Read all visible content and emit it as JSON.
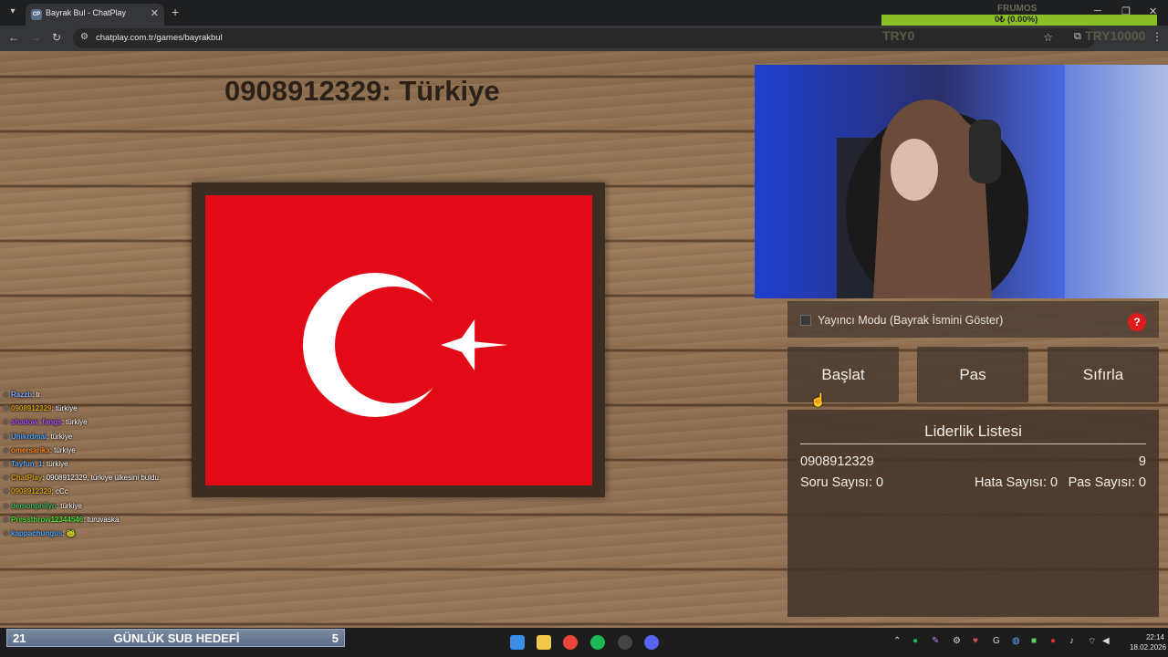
{
  "browser": {
    "tab_title": "Bayrak Bul - ChatPlay",
    "tab_favicon_text": "CP",
    "url": "chatplay.com.tr/games/bayrakbul",
    "new_tab_icon": "plus-icon",
    "close_tab_icon": "close-icon"
  },
  "overlay": {
    "label": "FRUMOS",
    "progress_text": "0₺ (0.00%)",
    "progress": 0,
    "start_amount": "TRY0",
    "goal_amount": "TRY10000",
    "bar_color": "#8bbd24"
  },
  "game": {
    "headline": "0908912329: Türkiye",
    "flag_country": "Türkiye",
    "flag_color": "#e30a17"
  },
  "chat": [
    {
      "user": "Razzb",
      "message": "tr",
      "color": "#7fa8ff"
    },
    {
      "user": "0908912329",
      "message": "türkiye",
      "color": "#d4a017"
    },
    {
      "user": "shadow_fangs",
      "message": "türkiye",
      "color": "#b04fff"
    },
    {
      "user": "Unikrdmal",
      "message": "türkiye",
      "color": "#4fa3ff"
    },
    {
      "user": "omersarika",
      "message": "türkiye",
      "color": "#ff8a1f"
    },
    {
      "user": "Tayfun_1",
      "message": "türkiye",
      "color": "#5aa0ff"
    },
    {
      "user": "ChatPlay",
      "message": "0908912329, türkiye ülkesini buldu",
      "color": "#d4a017"
    },
    {
      "user": "0908912329",
      "message": "cCc",
      "color": "#d4a017"
    },
    {
      "user": "demonphilyo",
      "message": "türkiye",
      "color": "#3dbb6a"
    },
    {
      "user": "Pressthrow12344546",
      "message": "turuvaska",
      "color": "#4ddc3a"
    },
    {
      "user": "kappachungus",
      "message": "🐸",
      "color": "#4fa3ff"
    }
  ],
  "panel": {
    "streamer_mode_label": "Yayıncı Modu (Bayrak İsmini Göster)",
    "streamer_mode_checked": false,
    "help_label": "?",
    "buttons": {
      "start": "Başlat",
      "pass": "Pas",
      "reset": "Sıfırla"
    },
    "leaderboard": {
      "title": "Liderlik Listesi",
      "entries": [
        {
          "name": "0908912329",
          "score": "9",
          "question_count": "Soru Sayısı: 0",
          "error_count": "Hata Sayısı: 0",
          "pass_count": "Pas Sayısı: 0"
        }
      ]
    }
  },
  "subgoal": {
    "current": "21",
    "label": "GÜNLÜK SUB HEDEFİ",
    "target": "5"
  },
  "taskbar": {
    "clock_time": "22:14",
    "clock_date": "18.02.2026"
  }
}
